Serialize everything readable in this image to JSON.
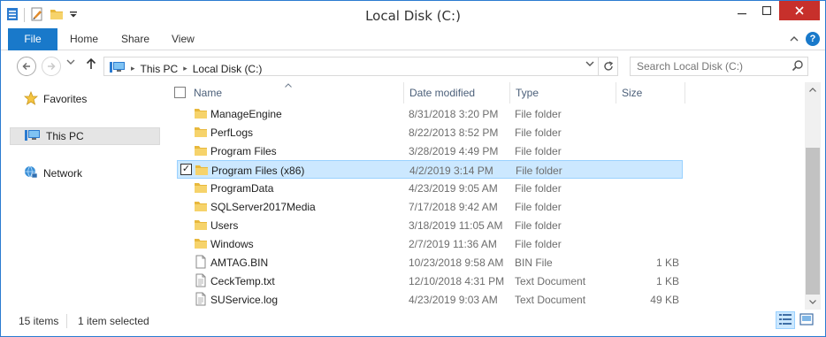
{
  "window": {
    "title": "Local Disk (C:)"
  },
  "ribbon": {
    "tabs": [
      {
        "label": "File"
      },
      {
        "label": "Home"
      },
      {
        "label": "Share"
      },
      {
        "label": "View"
      }
    ],
    "help_label": "?"
  },
  "address": {
    "crumbs": [
      "This PC",
      "Local Disk (C:)"
    ],
    "search_placeholder": "Search Local Disk (C:)"
  },
  "nav": {
    "items": [
      {
        "label": "Favorites",
        "icon": "star-icon"
      },
      {
        "label": "This PC",
        "icon": "computer-icon"
      },
      {
        "label": "Network",
        "icon": "network-icon"
      }
    ]
  },
  "columns": {
    "name": "Name",
    "date": "Date modified",
    "type": "Type",
    "size": "Size"
  },
  "rows": [
    {
      "name": "ManageEngine",
      "date": "8/31/2018 3:20 PM",
      "type": "File folder",
      "size": "",
      "icon": "folder-icon"
    },
    {
      "name": "PerfLogs",
      "date": "8/22/2013 8:52 PM",
      "type": "File folder",
      "size": "",
      "icon": "folder-icon"
    },
    {
      "name": "Program Files",
      "date": "3/28/2019 4:49 PM",
      "type": "File folder",
      "size": "",
      "icon": "folder-icon"
    },
    {
      "name": "Program Files (x86)",
      "date": "4/2/2019 3:14 PM",
      "type": "File folder",
      "size": "",
      "icon": "folder-icon"
    },
    {
      "name": "ProgramData",
      "date": "4/23/2019 9:05 AM",
      "type": "File folder",
      "size": "",
      "icon": "folder-icon"
    },
    {
      "name": "SQLServer2017Media",
      "date": "7/17/2018 9:42 AM",
      "type": "File folder",
      "size": "",
      "icon": "folder-icon"
    },
    {
      "name": "Users",
      "date": "3/18/2019 11:05 AM",
      "type": "File folder",
      "size": "",
      "icon": "folder-icon"
    },
    {
      "name": "Windows",
      "date": "2/7/2019 11:36 AM",
      "type": "File folder",
      "size": "",
      "icon": "folder-icon"
    },
    {
      "name": "AMTAG.BIN",
      "date": "10/23/2018 9:58 AM",
      "type": "BIN File",
      "size": "1 KB",
      "icon": "file-icon"
    },
    {
      "name": "CeckTemp.txt",
      "date": "12/10/2018 4:31 PM",
      "type": "Text Document",
      "size": "1 KB",
      "icon": "text-file-icon"
    },
    {
      "name": "SUService.log",
      "date": "4/23/2019 9:03 AM",
      "type": "Text Document",
      "size": "49 KB",
      "icon": "text-file-icon"
    }
  ],
  "selected_row_name": "Program Files (x86)",
  "status": {
    "count": "15 items",
    "selection": "1 item selected"
  },
  "colors": {
    "accent": "#1979ca",
    "close": "#c7302b",
    "selection": "#cce8ff",
    "folder": "#e8b83c"
  }
}
